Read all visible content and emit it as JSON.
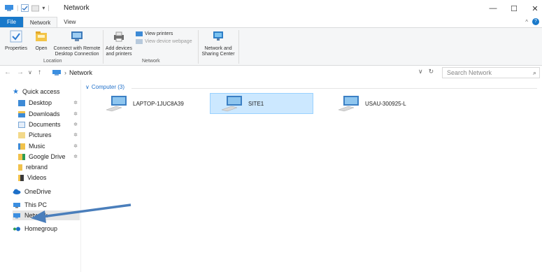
{
  "window": {
    "title": "Network",
    "minimize": "—",
    "maximize": "☐",
    "close": "✕"
  },
  "tabs": [
    {
      "label": "File"
    },
    {
      "label": "Network"
    },
    {
      "label": "View"
    }
  ],
  "ribbon": {
    "properties": "Properties",
    "open": "Open",
    "connect_remote_1": "Connect with Remote",
    "connect_remote_2": "Desktop Connection",
    "location_group": "Location",
    "add_devices_1": "Add devices",
    "add_devices_2": "and printers",
    "view_printers": "View printers",
    "view_device_webpage": "View device webpage",
    "network_center_1": "Network and",
    "network_center_2": "Sharing Center",
    "network_group": "Network"
  },
  "address": {
    "path_item": "Network",
    "search_placeholder": "Search Network"
  },
  "navpane": {
    "quick_access": "Quick access",
    "items": [
      {
        "label": "Desktop",
        "pinned": true
      },
      {
        "label": "Downloads",
        "pinned": true
      },
      {
        "label": "Documents",
        "pinned": true
      },
      {
        "label": "Pictures",
        "pinned": true
      },
      {
        "label": "Music",
        "pinned": true
      },
      {
        "label": "Google Drive",
        "pinned": true
      },
      {
        "label": "rebrand",
        "pinned": false
      },
      {
        "label": "Videos",
        "pinned": false
      }
    ],
    "onedrive": "OneDrive",
    "this_pc": "This PC",
    "network": "Network",
    "homegroup": "Homegroup"
  },
  "content": {
    "group_header": "Computer (3)",
    "computers": [
      {
        "name": "LAPTOP-1JUC8A39",
        "selected": false
      },
      {
        "name": "SITE1",
        "selected": true
      },
      {
        "name": "USAU-300925-L",
        "selected": false
      }
    ]
  },
  "colors": {
    "accent": "#1979ca",
    "selection": "#cce8ff",
    "annotation_arrow": "#4a7ebb"
  }
}
